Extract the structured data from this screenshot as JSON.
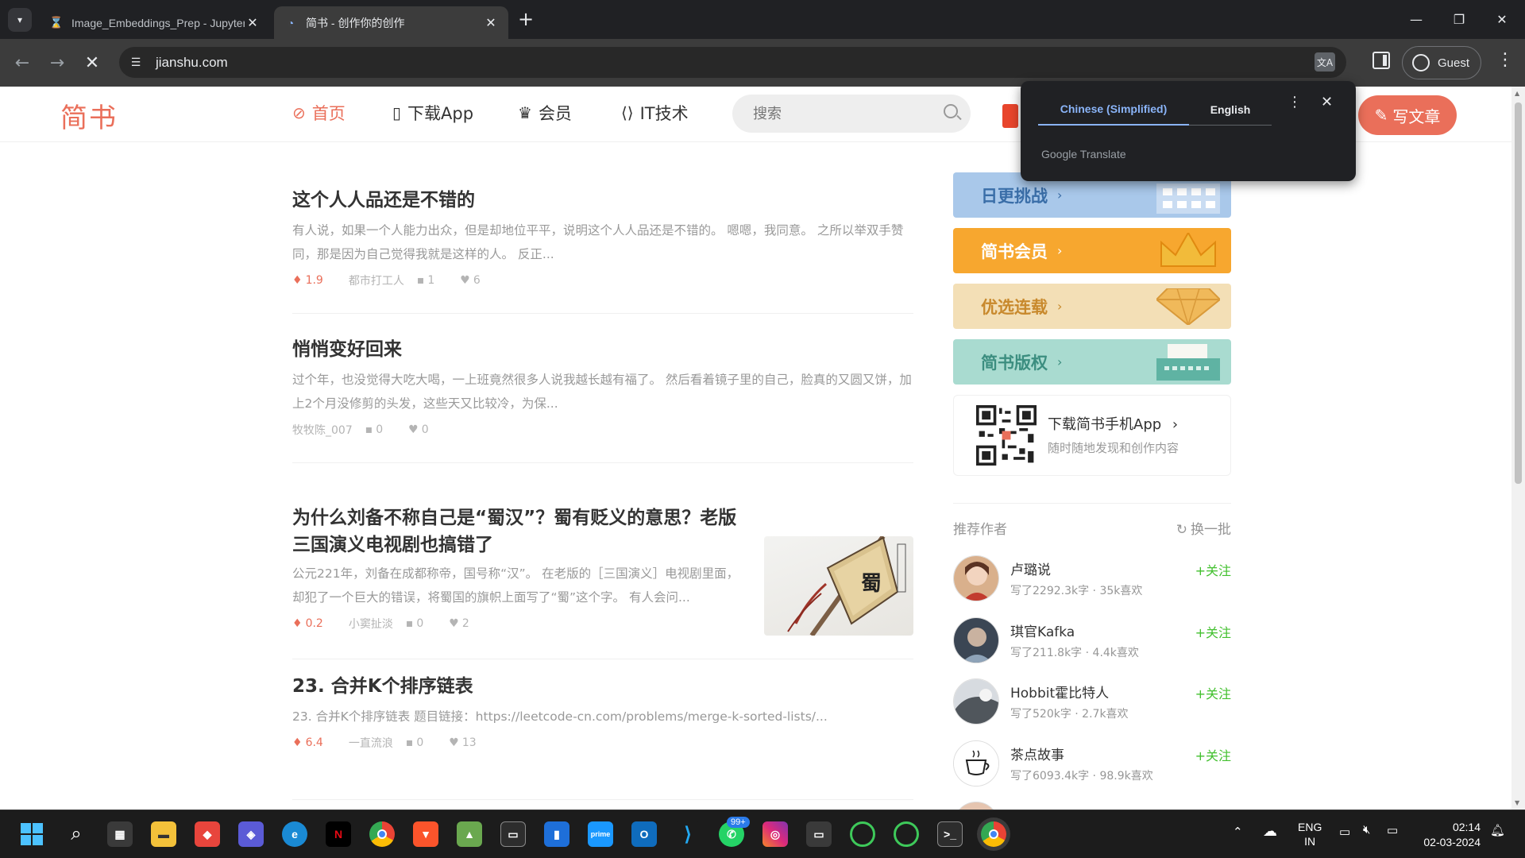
{
  "browser": {
    "tabs": [
      {
        "title": "Image_Embeddings_Prep - Jupyter",
        "icon": "hourglass-icon",
        "active": false
      },
      {
        "title": "简书 - 创作你的创作",
        "icon": "jianshu-icon",
        "active": true
      }
    ],
    "url": "jianshu.com",
    "profile_label": "Guest"
  },
  "translate_popup": {
    "source_lang": "Chinese (Simplified)",
    "target_lang": "English",
    "brand": "Google Translate"
  },
  "header": {
    "logo": "简书",
    "nav": [
      "首页",
      "下载App",
      "会员",
      "IT技术"
    ],
    "search_placeholder": "搜索",
    "write_label": "写文章"
  },
  "articles": [
    {
      "title": "这个人人品还是不错的",
      "abstract": "有人说，如果一个人能力出众，但是却地位平平，说明这个人人品还是不错的。 嗯嗯，我同意。 之所以举双手赞同，那是因为自己觉得我就是这样的人。 反正...",
      "diamond": "1.9",
      "author": "都市打工人",
      "comments": "1",
      "likes": "6"
    },
    {
      "title": "悄悄变好回来",
      "abstract": "过个年，也没觉得大吃大喝，一上班竟然很多人说我越长越有福了。 然后看着镜子里的自己，脸真的又圆又饼，加上2个月没修剪的头发，这些天又比较冷，为保...",
      "diamond": "",
      "author": "牧牧陈_007",
      "comments": "0",
      "likes": "0"
    },
    {
      "title": "为什么刘备不称自己是“蜀汉”？蜀有贬义的意思？老版三国演义电视剧也搞错了",
      "abstract": "公元221年，刘备在成都称帝，国号称“汉”。 在老版的［三国演义］电视剧里面，却犯了一个巨大的错误，将蜀国的旗帜上面写了“蜀”这个字。 有人会问...",
      "diamond": "0.2",
      "author": "小窦扯淡",
      "comments": "0",
      "likes": "2",
      "thumb_text": "蜀"
    },
    {
      "title": "23. 合并K个排序链表",
      "abstract": "23. 合并K个排序链表 题目链接：https://leetcode-cn.com/problems/merge-k-sorted-lists/...",
      "diamond": "6.4",
      "author": "一直流浪",
      "comments": "0",
      "likes": "13"
    }
  ],
  "sidebar": {
    "boards": [
      {
        "label": "日更挑战",
        "color": "#a9c8ea",
        "text_color": "#3a6ea8"
      },
      {
        "label": "简书会员",
        "color": "#f7a72f",
        "text_color": "#ffffff"
      },
      {
        "label": "优选连载",
        "color": "#f3dfb6",
        "text_color": "#c8892c"
      },
      {
        "label": "简书版权",
        "color": "#a9dbd0",
        "text_color": "#3c8e80"
      }
    ],
    "download": {
      "title": "下载简书手机App",
      "subtitle": "随时随地发现和创作内容"
    },
    "recommend_title": "推荐作者",
    "refresh_label": "换一批",
    "authors": [
      {
        "name": "卢璐说",
        "stat": "写了2292.3k字 · 35k喜欢",
        "follow": "+关注"
      },
      {
        "name": "琪官Kafka",
        "stat": "写了211.8k字 · 4.4k喜欢",
        "follow": "+关注"
      },
      {
        "name": "Hobbit霍比特人",
        "stat": "写了520k字 · 2.7k喜欢",
        "follow": "+关注"
      },
      {
        "name": "茶点故事",
        "stat": "写了6093.4k字 · 98.9k喜欢",
        "follow": "+关注"
      }
    ]
  },
  "taskbar": {
    "whatsapp_badge": "99+",
    "lang_line1": "ENG",
    "lang_line2": "IN",
    "time": "02:14",
    "date": "02-03-2024"
  }
}
